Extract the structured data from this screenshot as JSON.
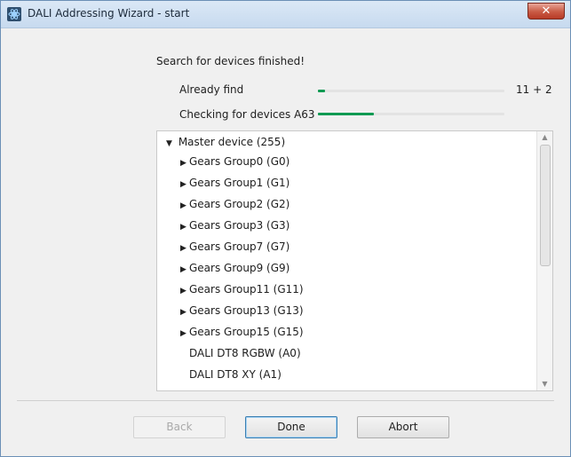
{
  "window": {
    "title": "DALI Addressing Wizard - start",
    "icon": "dali-app-icon",
    "close_label": "✕"
  },
  "status": {
    "heading": "Search for devices finished!",
    "already_find_label": "Already find",
    "already_find_progress": 0.04,
    "count_text": "11 + 2",
    "checking_label": "Checking for devices A63",
    "checking_progress": 0.3,
    "accent_color": "#0d9a52"
  },
  "tree": {
    "root": {
      "label": "Master device (255)",
      "expanded": true
    },
    "items": [
      {
        "label": "Gears Group0 (G0)",
        "has_children": true
      },
      {
        "label": "Gears Group1 (G1)",
        "has_children": true
      },
      {
        "label": "Gears Group2 (G2)",
        "has_children": true
      },
      {
        "label": "Gears Group3 (G3)",
        "has_children": true
      },
      {
        "label": "Gears Group7 (G7)",
        "has_children": true
      },
      {
        "label": "Gears Group9 (G9)",
        "has_children": true
      },
      {
        "label": "Gears Group11 (G11)",
        "has_children": true
      },
      {
        "label": "Gears Group13 (G13)",
        "has_children": true
      },
      {
        "label": "Gears Group15 (G15)",
        "has_children": true
      },
      {
        "label": "DALI DT8 RGBW (A0)",
        "has_children": false
      },
      {
        "label": "DALI DT8 XY (A1)",
        "has_children": false
      }
    ]
  },
  "buttons": {
    "back": "Back",
    "done": "Done",
    "abort": "Abort"
  }
}
